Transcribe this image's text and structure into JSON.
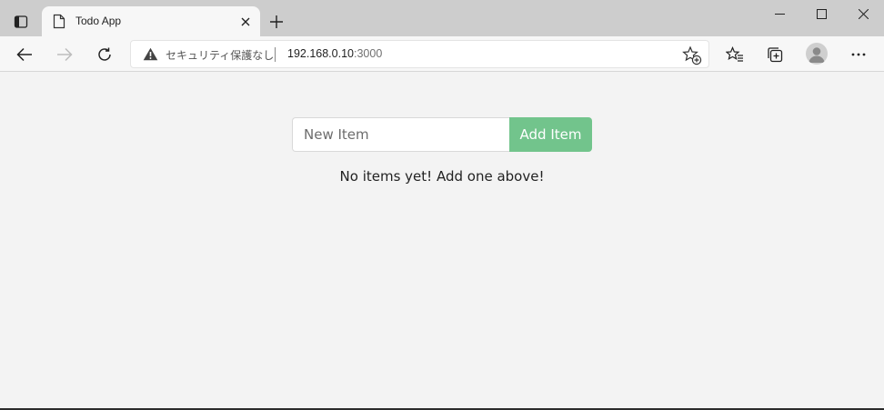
{
  "browser": {
    "tab_title": "Todo App",
    "security_label": "セキュリティ保護なし",
    "url_host": "192.168.0.10",
    "url_port": ":3000"
  },
  "icons": {
    "tab_actions": "tab-actions-icon",
    "favicon": "page-icon",
    "tab_close": "close-icon",
    "new_tab": "plus-icon",
    "minimize": "minimize-icon",
    "maximize": "maximize-icon",
    "close_window": "close-icon",
    "back": "arrow-left-icon",
    "forward": "arrow-right-icon",
    "refresh": "refresh-icon",
    "warning": "warning-icon",
    "add_favorite": "star-plus-icon",
    "favorites": "favorites-list-icon",
    "collections": "collections-icon",
    "profile": "avatar-icon",
    "more": "more-icon"
  },
  "todo": {
    "input_placeholder": "New Item",
    "input_value": "",
    "add_button_label": "Add Item",
    "empty_message": "No items yet! Add one above!"
  },
  "colors": {
    "add_button": "#72c48c",
    "titlebar": "#cdcdcd",
    "page_background": "#f3f3f3"
  }
}
